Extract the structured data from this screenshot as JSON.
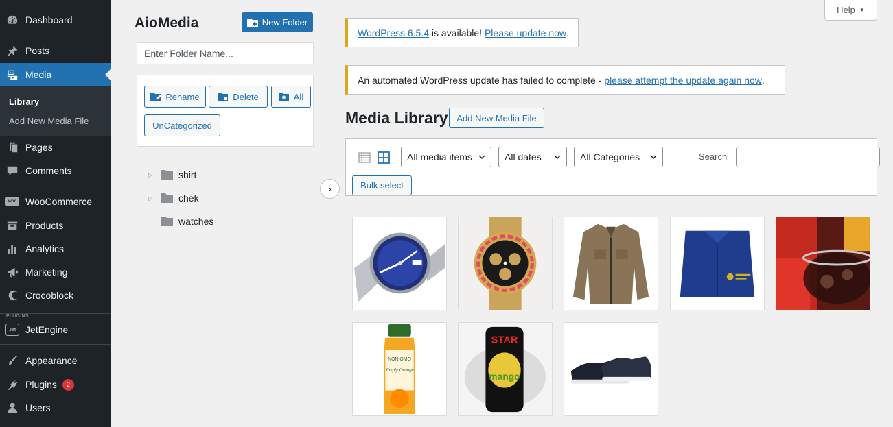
{
  "sidebar": {
    "items": [
      {
        "label": "Dashboard",
        "icon": "dashboard-icon"
      },
      {
        "label": "Posts",
        "icon": "pin-icon"
      },
      {
        "label": "Media",
        "icon": "media-icon"
      },
      {
        "label": "Pages",
        "icon": "pages-icon"
      },
      {
        "label": "Comments",
        "icon": "comments-icon"
      },
      {
        "label": "WooCommerce",
        "icon": "woocommerce-icon"
      },
      {
        "label": "Products",
        "icon": "products-icon"
      },
      {
        "label": "Analytics",
        "icon": "analytics-icon"
      },
      {
        "label": "Marketing",
        "icon": "megaphone-icon"
      },
      {
        "label": "Crocoblock",
        "icon": "crocoblock-icon"
      },
      {
        "label": "JetEngine",
        "icon": "jetengine-icon"
      },
      {
        "label": "Appearance",
        "icon": "paintbrush-icon"
      },
      {
        "label": "Plugins",
        "icon": "plugin-icon",
        "badge": "2"
      },
      {
        "label": "Users",
        "icon": "users-icon"
      }
    ],
    "media_submenu": [
      "Library",
      "Add New Media File"
    ],
    "plugins_group_tag": "PLUGINS",
    "woo_logo_text": "woo",
    "jet_logo_text": "Jet"
  },
  "aiomedia": {
    "title": "AioMedia",
    "new_folder_label": "New Folder",
    "folder_name_placeholder": "Enter Folder Name...",
    "actions": {
      "rename": "Rename",
      "delete": "Delete",
      "all": "All",
      "uncategorized": "UnCategorized"
    },
    "folders": [
      {
        "name": "shirt",
        "has_children": true
      },
      {
        "name": "chek",
        "has_children": true
      },
      {
        "name": "watches",
        "has_children": false
      }
    ],
    "collapse_glyph": "›"
  },
  "help": {
    "label": "Help",
    "glyph": "▼"
  },
  "notices": {
    "update_available": {
      "link1": "WordPress 6.5.4",
      "text": " is available! ",
      "link2": "Please update now",
      "end": "."
    },
    "update_failed": {
      "text": "An automated WordPress update has failed to complete - ",
      "link": "please attempt the update again now",
      "end": "."
    }
  },
  "media_library": {
    "title": "Media Library",
    "add_new_label": "Add New Media File",
    "filters": {
      "type": "All media items",
      "dates": "All dates",
      "categories": "All Categories"
    },
    "search_label": "Search",
    "search_value": "",
    "bulk_select_label": "Bulk select",
    "items": [
      {
        "name": "blue-dial-watch"
      },
      {
        "name": "gold-diamond-watch"
      },
      {
        "name": "brown-jacket"
      },
      {
        "name": "blue-shirt"
      },
      {
        "name": "soda-drinks"
      },
      {
        "name": "simply-orange-juice",
        "label_top": "NON GMO",
        "label_mid": "Simply Orange"
      },
      {
        "name": "star-mango-can",
        "label_top": "STAR",
        "label_mid": "mango"
      },
      {
        "name": "sneakers"
      }
    ]
  },
  "colors": {
    "sidebar_bg": "#1d2327",
    "accent": "#2271b1",
    "notice_warning": "#dba617",
    "badge": "#d63638"
  }
}
